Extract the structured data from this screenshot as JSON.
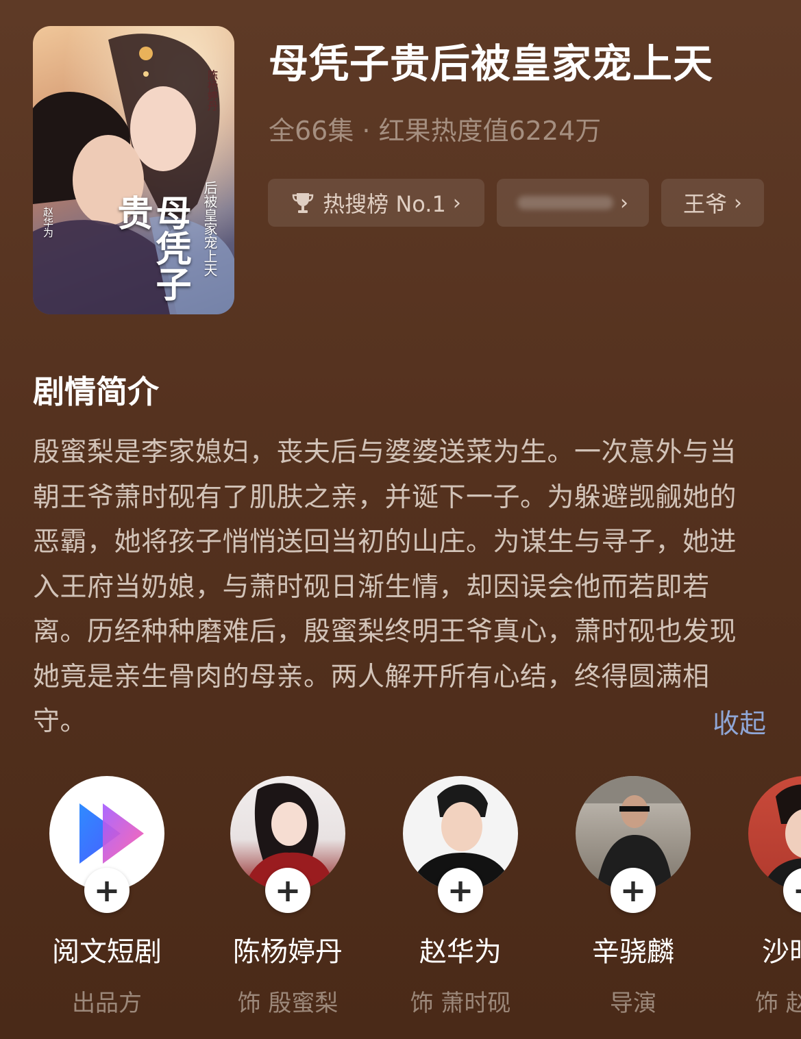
{
  "drama": {
    "title": "母凭子贵后被皇家宠上天",
    "meta": "全66集 · 红果热度值6224万",
    "poster": {
      "title": "母凭子贵",
      "subtitle": "后被皇家宠上天",
      "credit_top": "陈杨婷丹",
      "credit_bottom": "赵华为"
    }
  },
  "tags": [
    {
      "label": "热搜榜 No.1",
      "icon": "trophy-icon"
    },
    {
      "label": ""
    },
    {
      "label": "王爷"
    }
  ],
  "synopsis": {
    "heading": "剧情简介",
    "text": "殷蜜梨是李家媳妇，丧夫后与婆婆送菜为生。一次意外与当朝王爷萧时砚有了肌肤之亲，并诞下一子。为躲避觊觎她的恶霸，她将孩子悄悄送回当初的山庄。为谋生与寻子，她进入王府当奶娘，与萧时砚日渐生情，却因误会他而若即若离。历经种种磨难后，殷蜜梨终明王爷真心，萧时砚也发现她竟是亲生骨肉的母亲。两人解开所有心结，终得圆满相守。",
    "collapse_label": "收起"
  },
  "cast": [
    {
      "name": "阅文短剧",
      "role": "出品方"
    },
    {
      "name": "陈杨婷丹",
      "role": "饰 殷蜜梨"
    },
    {
      "name": "赵华为",
      "role": "饰 萧时砚"
    },
    {
      "name": "辛骁麟",
      "role": "导演"
    },
    {
      "name": "沙时",
      "role": "饰 赵"
    }
  ],
  "ui": {
    "plus_symbol": "+",
    "chevron": "›"
  }
}
